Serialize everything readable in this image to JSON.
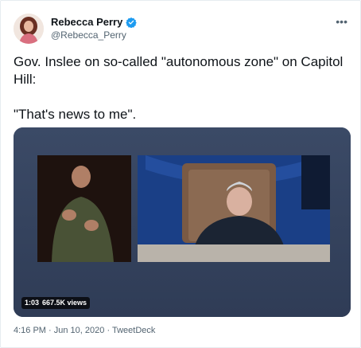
{
  "author": {
    "display_name": "Rebecca Perry",
    "handle": "@Rebecca_Perry",
    "verified_color": "#1d9bf0"
  },
  "tweet": {
    "text": "Gov. Inslee on so-called \"autonomous zone\" on Capitol Hill:\n\n\"That's news to me\"."
  },
  "video": {
    "duration": "1:03",
    "views": "667.5K views"
  },
  "meta": {
    "time": "4:16 PM",
    "separator": "·",
    "date": "Jun 10, 2020",
    "source": "TweetDeck"
  },
  "more_icon": "more-horizontal-icon"
}
